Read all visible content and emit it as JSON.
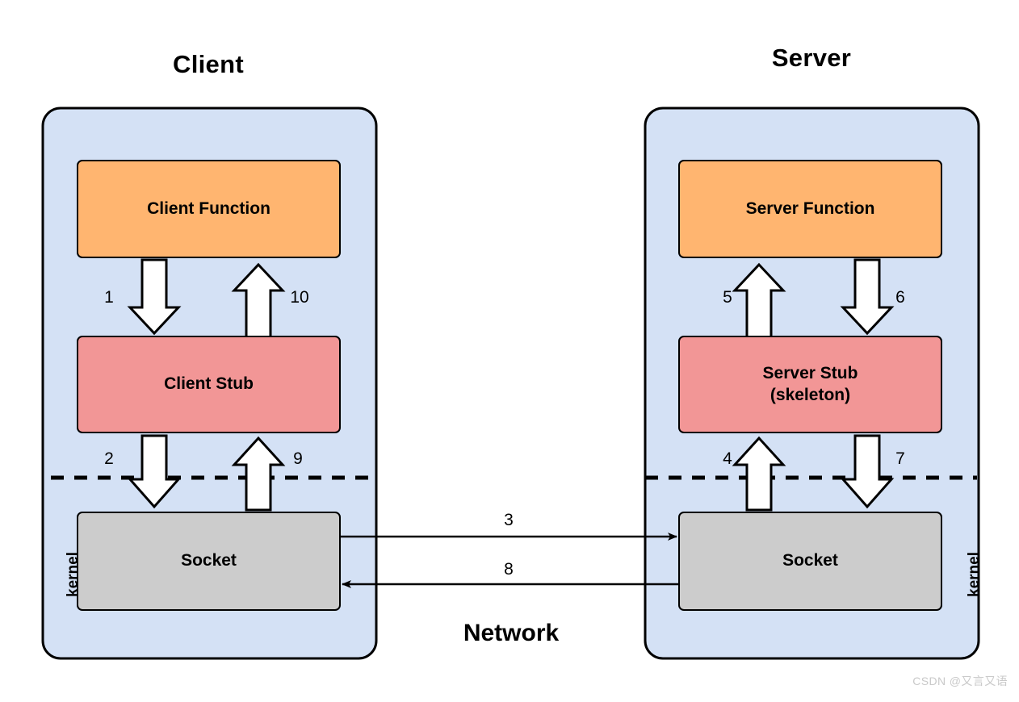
{
  "diagram": {
    "title_client": "Client",
    "title_server": "Server",
    "network_label": "Network",
    "watermark": "CSDN @又言又语",
    "colors": {
      "container_fill": "#d4e1f5",
      "function_fill": "#ffb570",
      "stub_fill": "#f29696",
      "socket_fill": "#cccccc",
      "stroke": "#000000",
      "background": "#ffffff",
      "watermark": "#c9c9c9"
    }
  },
  "client": {
    "kernel_label": "kernel",
    "boxes": {
      "function": "Client Function",
      "stub": "Client Stub",
      "socket": "Socket"
    },
    "steps": {
      "fn_to_stub": "1",
      "stub_to_socket": "2",
      "socket_to_stub": "9",
      "stub_to_fn": "10"
    }
  },
  "server": {
    "kernel_label": "kernel",
    "boxes": {
      "function": "Server Function",
      "stub_line1": "Server Stub",
      "stub_line2": "(skeleton)",
      "socket": "Socket"
    },
    "steps": {
      "socket_to_stub": "4",
      "stub_to_fn": "5",
      "fn_to_stub": "6",
      "stub_to_socket": "7"
    }
  },
  "network": {
    "request_step": "3",
    "response_step": "8"
  }
}
